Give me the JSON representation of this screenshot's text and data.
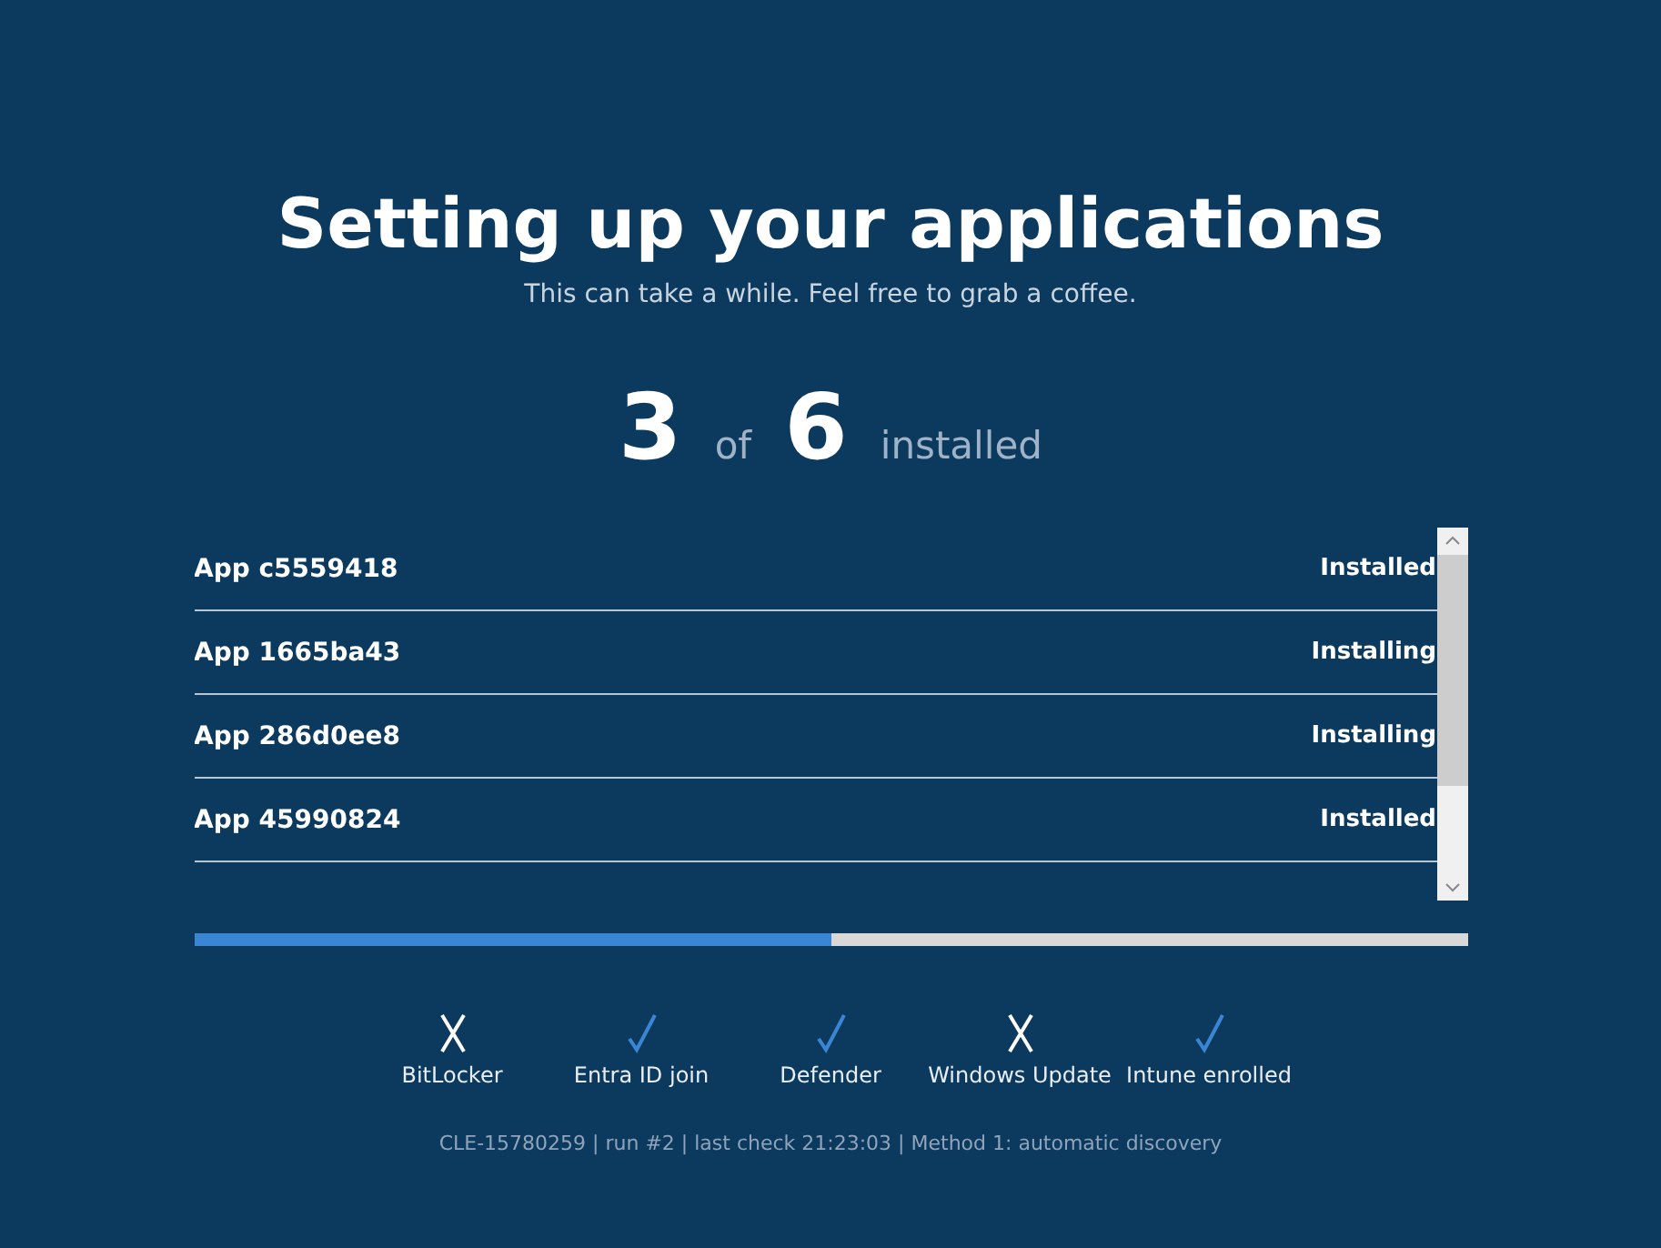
{
  "title": "Setting up your applications",
  "subtitle": "This can take a while. Feel free to grab a coffee.",
  "counter": {
    "done": "3",
    "of": "of",
    "total": "6",
    "suffix": "installed"
  },
  "apps": [
    {
      "name": "App c5559418",
      "status": "Installed"
    },
    {
      "name": "App 1665ba43",
      "status": "Installing"
    },
    {
      "name": "App 286d0ee8",
      "status": "Installing"
    },
    {
      "name": "App 45990824",
      "status": "Installed"
    }
  ],
  "progress": {
    "level": 0.5
  },
  "checks": [
    {
      "label": "BitLocker",
      "ok": false
    },
    {
      "label": "Entra ID join",
      "ok": true
    },
    {
      "label": "Defender",
      "ok": true
    },
    {
      "label": "Windows Update",
      "ok": false
    },
    {
      "label": "Intune enrolled",
      "ok": true
    }
  ],
  "footer": "CLE-15780259 | run #2 | last check 21:23:03 | Method 1: automatic discovery"
}
